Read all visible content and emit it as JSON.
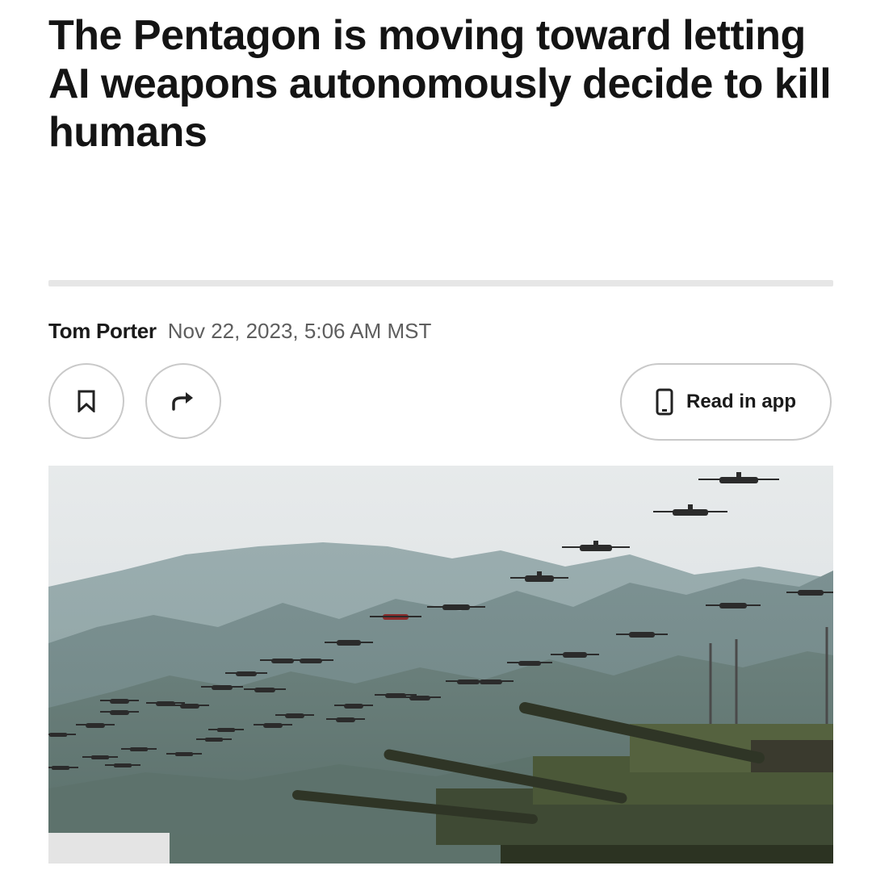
{
  "article": {
    "headline": "The Pentagon is moving toward letting AI weapons autonomously decide to kill humans",
    "author": "Tom Porter",
    "date": "Nov 22, 2023, 5:06 AM MST"
  },
  "actions": {
    "bookmark_icon": "bookmark-icon",
    "share_icon": "share-arrow-icon",
    "read_in_app_label": "Read in app",
    "read_in_app_icon": "phone-icon"
  },
  "image": {
    "subject": "drone swarm over mountains with tanks in foreground"
  },
  "colors": {
    "text": "#141414",
    "muted": "#5e5e5e",
    "border": "#c9c9c9",
    "divider": "#e6e6e6"
  }
}
